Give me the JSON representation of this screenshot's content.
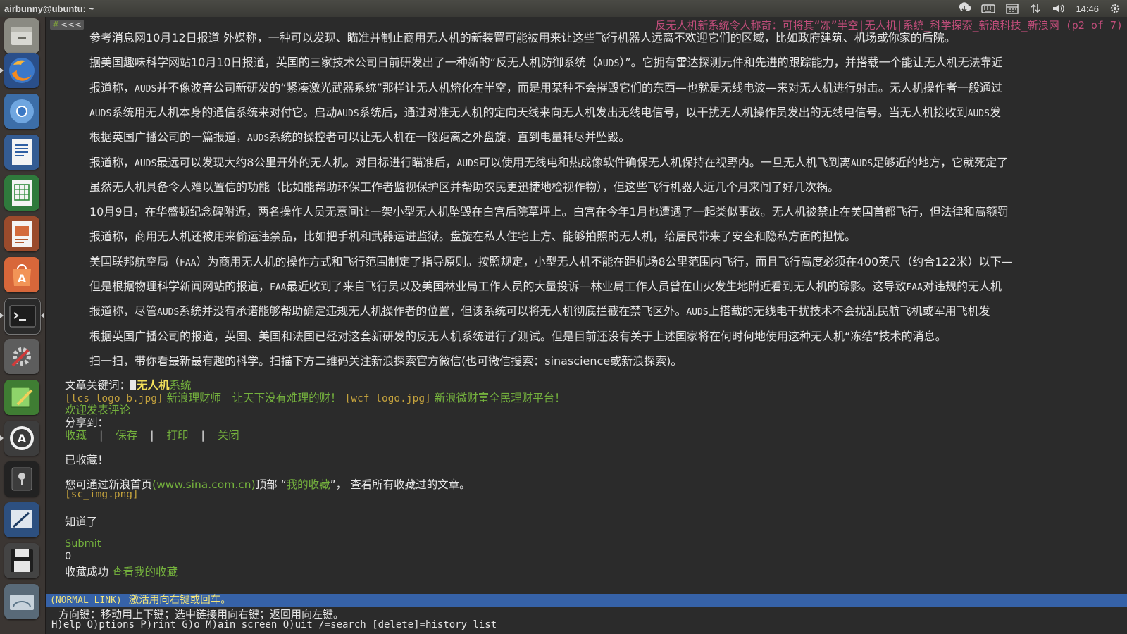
{
  "window": {
    "title": "airbunny@ubuntu: ~"
  },
  "tray": {
    "clock": "14:46"
  },
  "launcher": {
    "items": [
      {
        "name": "files-icon"
      },
      {
        "name": "firefox-icon"
      },
      {
        "name": "chromium-icon"
      },
      {
        "name": "writer-icon"
      },
      {
        "name": "calc-icon"
      },
      {
        "name": "impress-icon"
      },
      {
        "name": "software-center-icon"
      },
      {
        "name": "terminal-icon"
      },
      {
        "name": "system-settings-icon"
      },
      {
        "name": "text-editor-icon"
      },
      {
        "name": "software-updater-icon"
      },
      {
        "name": "disk-utility-icon"
      },
      {
        "name": "screenshot-icon"
      },
      {
        "name": "save-icon"
      },
      {
        "name": "disk-image-icon"
      }
    ]
  },
  "browser": {
    "header": "反无人机新系统令人称奇：可将其“冻”半空|无人机|系统_科学探索_新浪科技_新浪网 (p2 of 7)",
    "back_label": "<<<",
    "hash": "#"
  },
  "article": {
    "paragraphs": [
      [
        "参考消息网10月12日报道 外媒称，一种可以发现、瞄准并制止商用无人机的新装置可能被用来让这些飞行机器人远离不欢迎它们的区域，比如政府建筑、机场或你家的后院。"
      ],
      [
        "据美国趣味科学网站10月10日报道，英国的三家技术公司日前研发出了一种新的“反无人机防御系统（",
        "AUDS",
        "）”。它拥有雷达探测元件和先进的跟踪能力，并搭载一个能让无人机无法靠近"
      ],
      [
        "报道称，",
        "AUDS",
        "并不像波音公司新研发的“紧凑激光武器系统”那样让无人机熔化在半空，而是用某种不会摧毁它们的东西—也就是无线电波—来对无人机进行射击。无人机操作者一般通过"
      ],
      [
        "AUDS",
        "系统用无人机本身的通信系统来对付它。启动",
        "AUDS",
        "系统后，通过对准无人机的定向天线来向无人机发出无线电信号，以干扰无人机操作员发出的无线电信号。当无人机接收到",
        "AUDS",
        "发"
      ],
      [
        "根据英国广播公司的一篇报道，",
        "AUDS",
        "系统的操控者可以让无人机在一段距离之外盘旋，直到电量耗尽并坠毁。"
      ],
      [
        "报道称，",
        "AUDS",
        "最远可以发现大约8公里开外的无人机。对目标进行瞄准后，",
        "AUDS",
        "可以使用无线电和热成像软件确保无人机保持在视野内。一旦无人机飞到离",
        "AUDS",
        "足够近的地方，它就死定了"
      ],
      [
        "虽然无人机具备令人难以置信的功能（比如能帮助环保工作者监视保护区并帮助农民更迅捷地检视作物），但这些飞行机器人近几个月来闯了好几次祸。"
      ],
      [
        "10月9日，在华盛顿纪念碑附近，两名操作人员无意间让一架小型无人机坠毁在白宫后院草坪上。白宫在今年1月也遭遇了一起类似事故。无人机被禁止在美国首都飞行，但法律和高额罚"
      ],
      [
        "报道称，商用无人机还被用来偷运违禁品，比如把手机和武器运进监狱。盘旋在私人住宅上方、能够拍照的无人机，给居民带来了安全和隐私方面的担忧。"
      ],
      [
        "美国联邦航空局（",
        "FAA",
        "）为商用无人机的操作方式和飞行范围制定了指导原则。按照规定，小型无人机不能在距机场8公里范围内飞行，而且飞行高度必须在400英尺（约合122米）以下—"
      ],
      [
        "但是根据物理科学新闻网站的报道，",
        "FAA",
        "最近收到了来自飞行员以及美国林业局工作人员的大量投诉—林业局工作人员曾在山火发生地附近看到无人机的踪影。这导致",
        "FAA",
        "对违规的无人机"
      ],
      [
        "报道称，尽管",
        "AUDS",
        "系统并没有承诺能够帮助确定违规无人机操作者的位置，但该系统可以将无人机彻底拦截在禁飞区外。",
        "AUDS",
        "上搭载的无线电干扰技术不会扰乱民航飞机或军用飞机发"
      ],
      [
        "根据英国广播公司的报道，英国、美国和法国已经对这套新研发的反无人机系统进行了测试。但是目前还没有关于上述国家将在何时何地使用这种无人机“冻结”技术的消息。"
      ],
      [
        "扫一扫，带你看最新最有趣的科学。扫描下方二维码关注新浪探索官方微信(也可微信搜索：sinascience或新浪探索)。"
      ]
    ],
    "keywords_label": "文章关键词：",
    "keyword_selected": "无人机",
    "keyword_other": "系统"
  },
  "footer": {
    "ad_line": {
      "img1": "[lcs_logo_b.jpg]",
      "link1": "新浪理财师　让天下没有难理的财！",
      "img2": "[wcf_logo.jpg]",
      "link2": "新浪微财富全民理财平台！"
    },
    "comment_link": "欢迎发表评论",
    "share_label": "分享到：",
    "actions": [
      "收藏",
      "保存",
      "打印",
      "关闭"
    ],
    "action_sep": "|",
    "saved": "已收藏！",
    "saved_info_prefix": "您可通过新浪首页",
    "saved_info_url": "(www.sina.com.cn)",
    "saved_info_mid": "顶部 “",
    "saved_info_link": "我的收藏",
    "saved_info_suffix": "”， 查看所有收藏过的文章。",
    "sc_img": "[sc_img.png]",
    "got_it": "知道了",
    "submit": "Submit",
    "zero": "0",
    "success_prefix": "收藏成功 ",
    "success_link": "查看我的收藏"
  },
  "status": {
    "mode": "(NORMAL LINK)",
    "message": "激活用向右键或回车。",
    "hint": "方向键：移动用上下键；选中链接用向右键；返回用向左键。",
    "commands": "H)elp O)ptions P)rint G)o M)ain screen Q)uit /=search [delete]=history list"
  }
}
